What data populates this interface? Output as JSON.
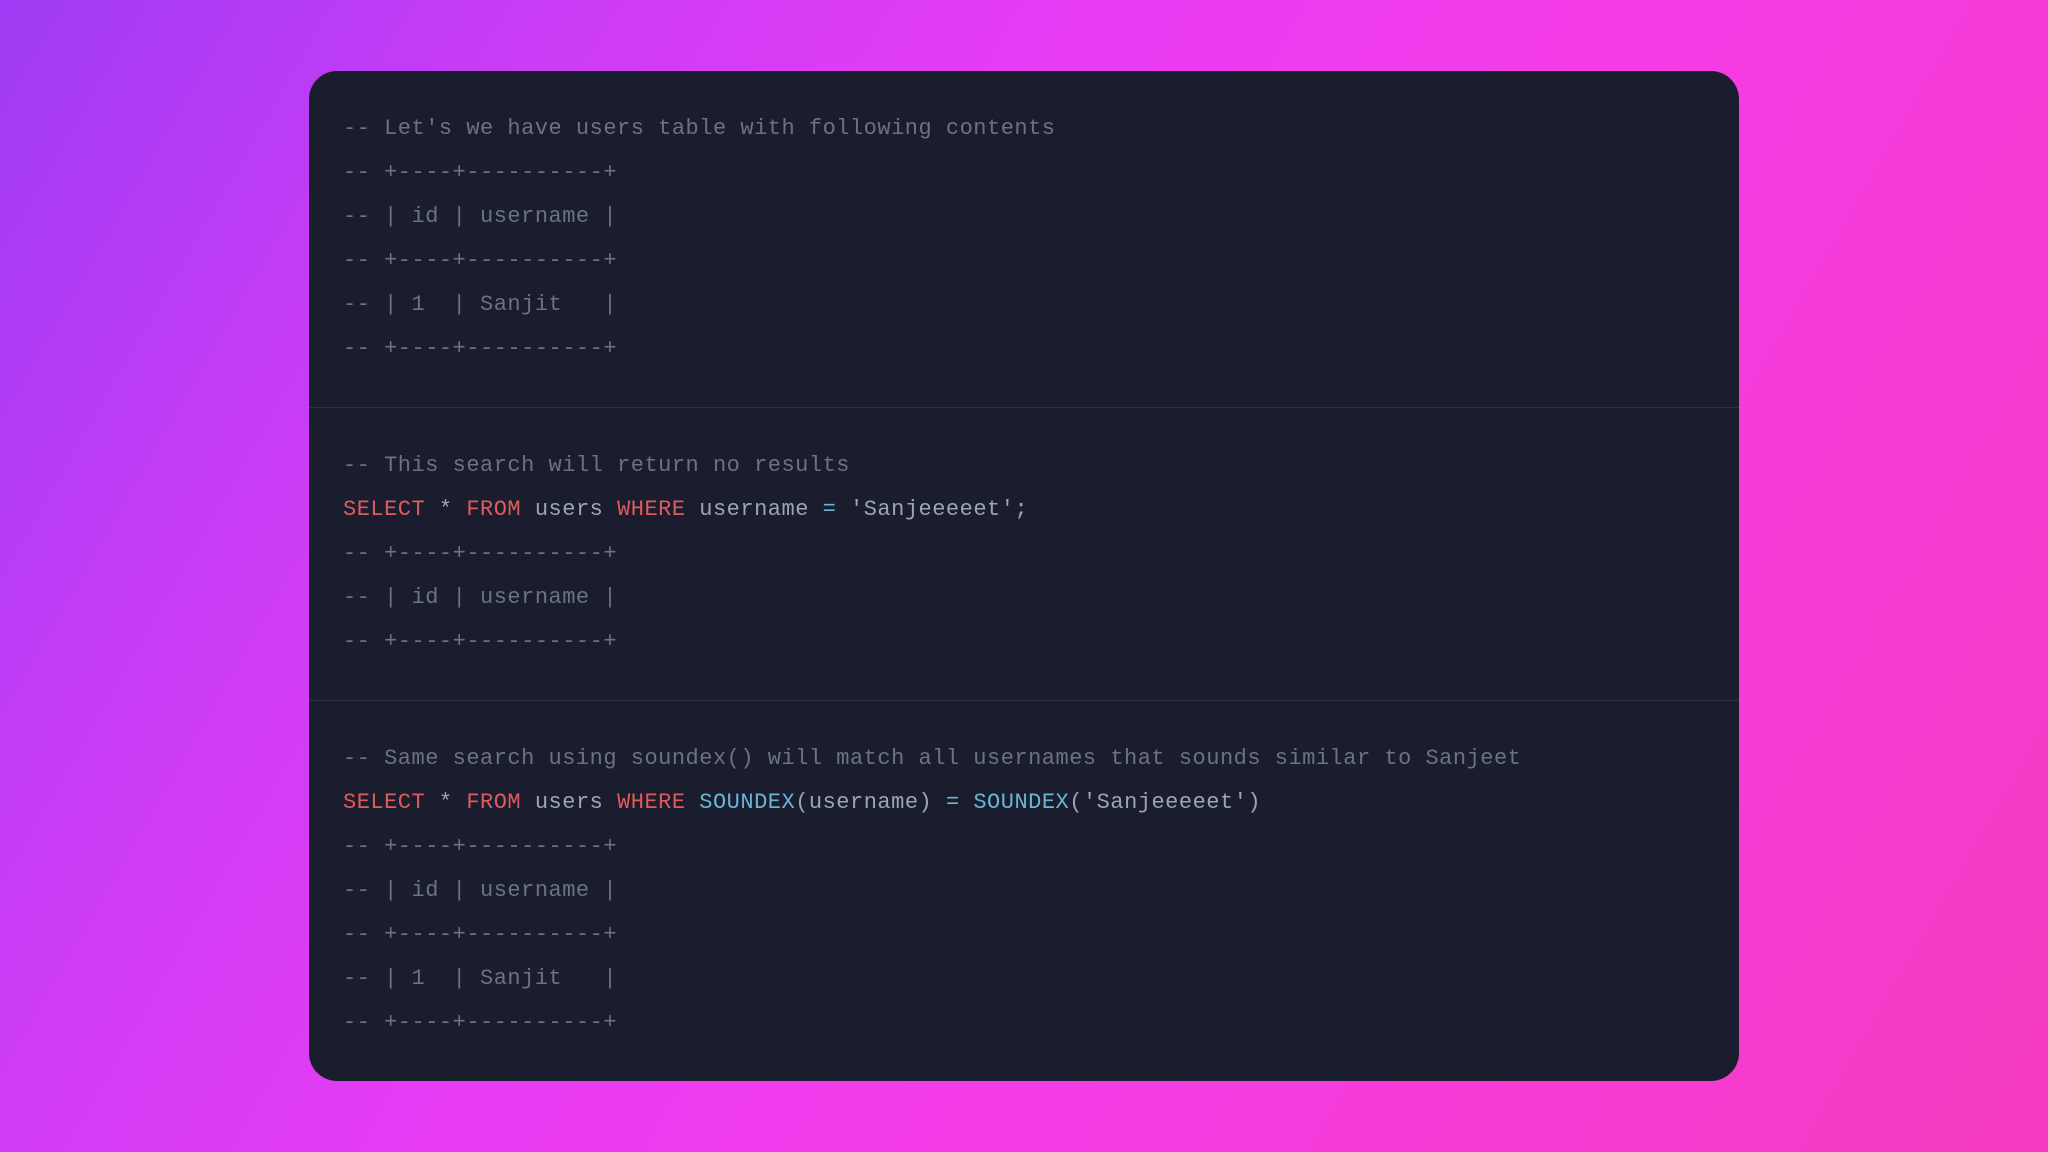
{
  "colors": {
    "background_dark": "#1a1d2e",
    "comment": "#6b7280",
    "keyword": "#e15a5a",
    "text": "#9ca5b4",
    "function": "#6ab5d4",
    "divider": "#2a2f44"
  },
  "blocks": [
    {
      "lines": [
        {
          "spans": [
            {
              "cls": "comment",
              "text": "-- Let's we have users table with following contents"
            }
          ]
        },
        {
          "spans": [
            {
              "cls": "comment",
              "text": "-- +----+----------+"
            }
          ]
        },
        {
          "spans": [
            {
              "cls": "comment",
              "text": "-- | id | username |"
            }
          ]
        },
        {
          "spans": [
            {
              "cls": "comment",
              "text": "-- +----+----------+"
            }
          ]
        },
        {
          "spans": [
            {
              "cls": "comment",
              "text": "-- | 1  | Sanjit   |"
            }
          ]
        },
        {
          "spans": [
            {
              "cls": "comment",
              "text": "-- +----+----------+"
            }
          ]
        }
      ]
    },
    {
      "lines": [
        {
          "spans": [
            {
              "cls": "comment",
              "text": "-- This search will return no results"
            }
          ]
        },
        {
          "spans": [
            {
              "cls": "keyword",
              "text": "SELECT"
            },
            {
              "cls": "text",
              "text": " * "
            },
            {
              "cls": "keyword",
              "text": "FROM"
            },
            {
              "cls": "text",
              "text": " users "
            },
            {
              "cls": "keyword",
              "text": "WHERE"
            },
            {
              "cls": "text",
              "text": " username "
            },
            {
              "cls": "operator",
              "text": "="
            },
            {
              "cls": "text",
              "text": " "
            },
            {
              "cls": "string",
              "text": "'Sanjeeeeet'"
            },
            {
              "cls": "text",
              "text": ";"
            }
          ]
        },
        {
          "spans": [
            {
              "cls": "text",
              "text": ""
            }
          ]
        },
        {
          "spans": [
            {
              "cls": "comment",
              "text": "-- +----+----------+"
            }
          ]
        },
        {
          "spans": [
            {
              "cls": "comment",
              "text": "-- | id | username |"
            }
          ]
        },
        {
          "spans": [
            {
              "cls": "comment",
              "text": "-- +----+----------+"
            }
          ]
        }
      ]
    },
    {
      "lines": [
        {
          "spans": [
            {
              "cls": "comment",
              "text": "-- Same search using soundex() will match all usernames that sounds similar to Sanjeet"
            }
          ]
        },
        {
          "spans": [
            {
              "cls": "keyword",
              "text": "SELECT"
            },
            {
              "cls": "text",
              "text": " * "
            },
            {
              "cls": "keyword",
              "text": "FROM"
            },
            {
              "cls": "text",
              "text": " users "
            },
            {
              "cls": "keyword",
              "text": "WHERE"
            },
            {
              "cls": "text",
              "text": " "
            },
            {
              "cls": "function",
              "text": "SOUNDEX"
            },
            {
              "cls": "text",
              "text": "(username) "
            },
            {
              "cls": "operator",
              "text": "="
            },
            {
              "cls": "text",
              "text": " "
            },
            {
              "cls": "function",
              "text": "SOUNDEX"
            },
            {
              "cls": "text",
              "text": "("
            },
            {
              "cls": "string",
              "text": "'Sanjeeeeet'"
            },
            {
              "cls": "text",
              "text": ")"
            }
          ]
        },
        {
          "spans": [
            {
              "cls": "text",
              "text": ""
            }
          ]
        },
        {
          "spans": [
            {
              "cls": "comment",
              "text": "-- +----+----------+"
            }
          ]
        },
        {
          "spans": [
            {
              "cls": "comment",
              "text": "-- | id | username |"
            }
          ]
        },
        {
          "spans": [
            {
              "cls": "comment",
              "text": "-- +----+----------+"
            }
          ]
        },
        {
          "spans": [
            {
              "cls": "comment",
              "text": "-- | 1  | Sanjit   |"
            }
          ]
        },
        {
          "spans": [
            {
              "cls": "comment",
              "text": "-- +----+----------+"
            }
          ]
        }
      ]
    }
  ]
}
